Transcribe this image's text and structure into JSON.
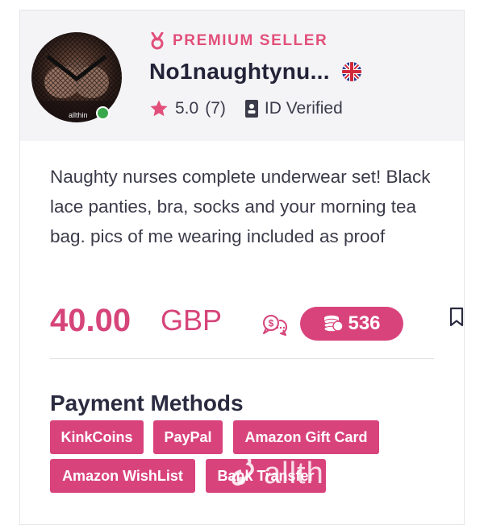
{
  "seller": {
    "badge_label": "PREMIUM SELLER",
    "name": "No1naughtynu...",
    "rating": "5.0",
    "review_count": "(7)",
    "verified_label": "ID Verified",
    "avatar_watermark": "allthin",
    "flag_icon": "uk-flag-icon",
    "online_status_color": "#3aa84a"
  },
  "listing": {
    "description": "Naughty nurses complete underwear set! Black lace panties, bra, socks and your morning tea bag. pics of me wearing included as proof",
    "price_amount": "40.00",
    "price_currency": "GBP",
    "kinkcoins_price": "536"
  },
  "payment": {
    "title": "Payment Methods",
    "methods": [
      "KinkCoins",
      "PayPal",
      "Amazon Gift Card",
      "Amazon WishList",
      "Bank Transfer"
    ]
  },
  "watermark": {
    "text": "allthi"
  },
  "colors": {
    "accent": "#d9437c",
    "badge_text": "#e24f7a",
    "header_bg": "#f4f4f7",
    "text_dark": "#222238",
    "text_body": "#3b3b4a"
  },
  "icons": {
    "badge": "medal-icon",
    "star": "star-icon",
    "id": "id-card-icon",
    "chat": "price-chat-icon",
    "coins": "coins-stack-icon",
    "bookmark": "bookmark-icon"
  }
}
